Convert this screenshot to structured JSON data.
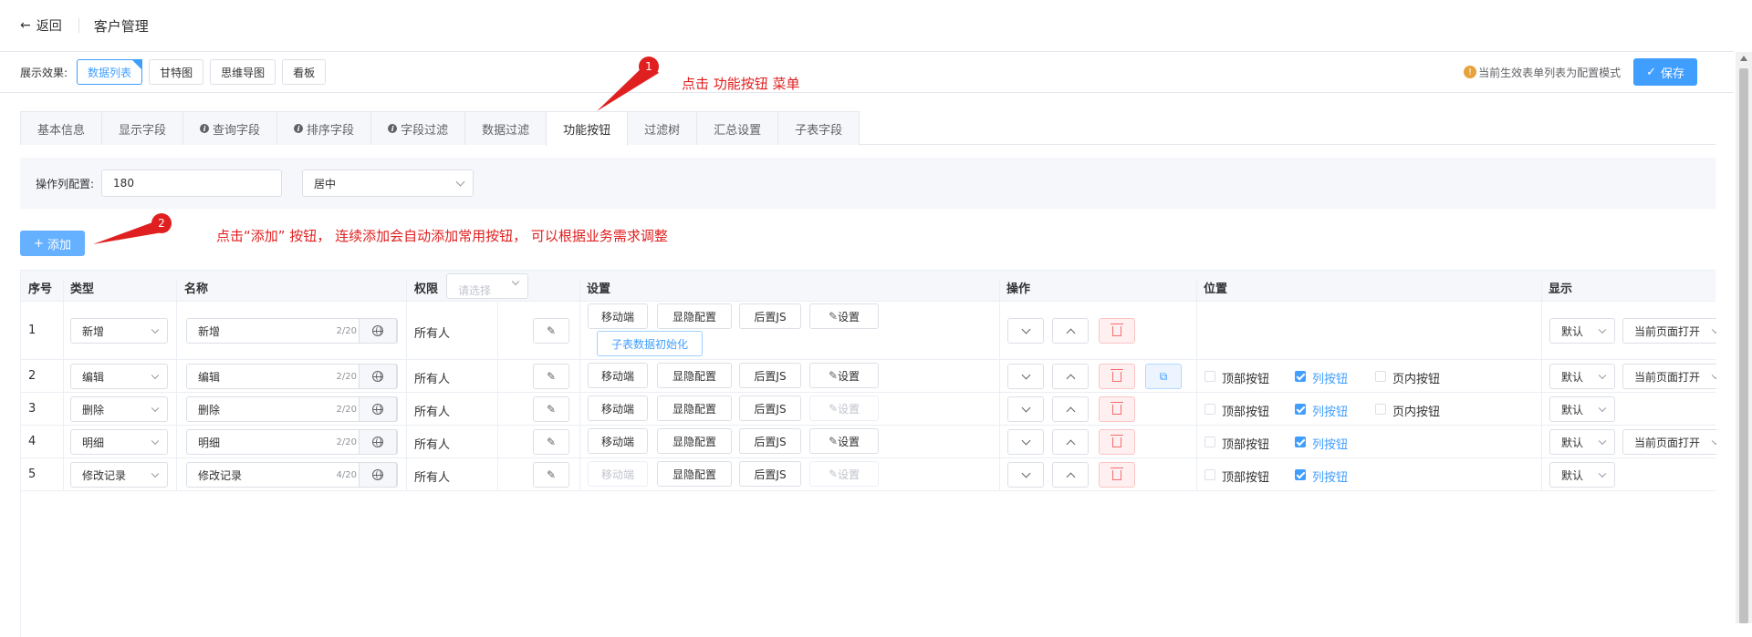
{
  "header": {
    "back_label": "返回",
    "title": "客户管理"
  },
  "viewbar": {
    "label": "展示效果:",
    "views": [
      "数据列表",
      "甘特图",
      "思维导图",
      "看板"
    ],
    "active": 0,
    "notice": "当前生效表单列表为配置模式",
    "save_label": "保存"
  },
  "tabs": [
    "基本信息",
    "显示字段",
    "查询字段",
    "排序字段",
    "字段过滤",
    "数据过滤",
    "功能按钮",
    "过滤树",
    "汇总设置",
    "子表字段"
  ],
  "tab_info": [
    false,
    false,
    true,
    true,
    true,
    false,
    false,
    false,
    false,
    false
  ],
  "active_tab": 6,
  "annotations": {
    "a1_num": "1",
    "a1_text": "点击 功能按钮 菜单",
    "a2_num": "2",
    "a2_text": "点击“添加” 按钮， 连续添加会自动添加常用按钮， 可以根据业务需求调整"
  },
  "opcfg": {
    "label": "操作列配置:",
    "width": "180",
    "align": "居中"
  },
  "add_label": "添加",
  "table": {
    "headers": {
      "no": "序号",
      "type": "类型",
      "name": "名称",
      "perm": "权限",
      "perm_placeholder": "请选择",
      "settings": "设置",
      "ops": "操作",
      "pos": "位置",
      "display": "显示"
    },
    "btn_labels": {
      "mobile": "移动端",
      "show_hide": "显隐配置",
      "post_js": "后置JS",
      "settings": "设置",
      "subinit": "子表数据初始化"
    },
    "pos_labels": {
      "top": "顶部按钮",
      "list": "列按钮",
      "inpage": "页内按钮"
    },
    "rows": [
      {
        "no": "1",
        "type": "新增",
        "name": "新增",
        "count": "2/20",
        "perm": "所有人",
        "display": "默认",
        "open": "当前页面打开"
      },
      {
        "no": "2",
        "type": "编辑",
        "name": "编辑",
        "count": "2/20",
        "perm": "所有人",
        "display": "默认",
        "open": "当前页面打开"
      },
      {
        "no": "3",
        "type": "删除",
        "name": "删除",
        "count": "2/20",
        "perm": "所有人",
        "display": "默认",
        "open": ""
      },
      {
        "no": "4",
        "type": "明细",
        "name": "明细",
        "count": "2/20",
        "perm": "所有人",
        "display": "默认",
        "open": "当前页面打开"
      },
      {
        "no": "5",
        "type": "修改记录",
        "name": "修改记录",
        "count": "4/20",
        "perm": "所有人",
        "display": "默认",
        "open": ""
      }
    ]
  }
}
